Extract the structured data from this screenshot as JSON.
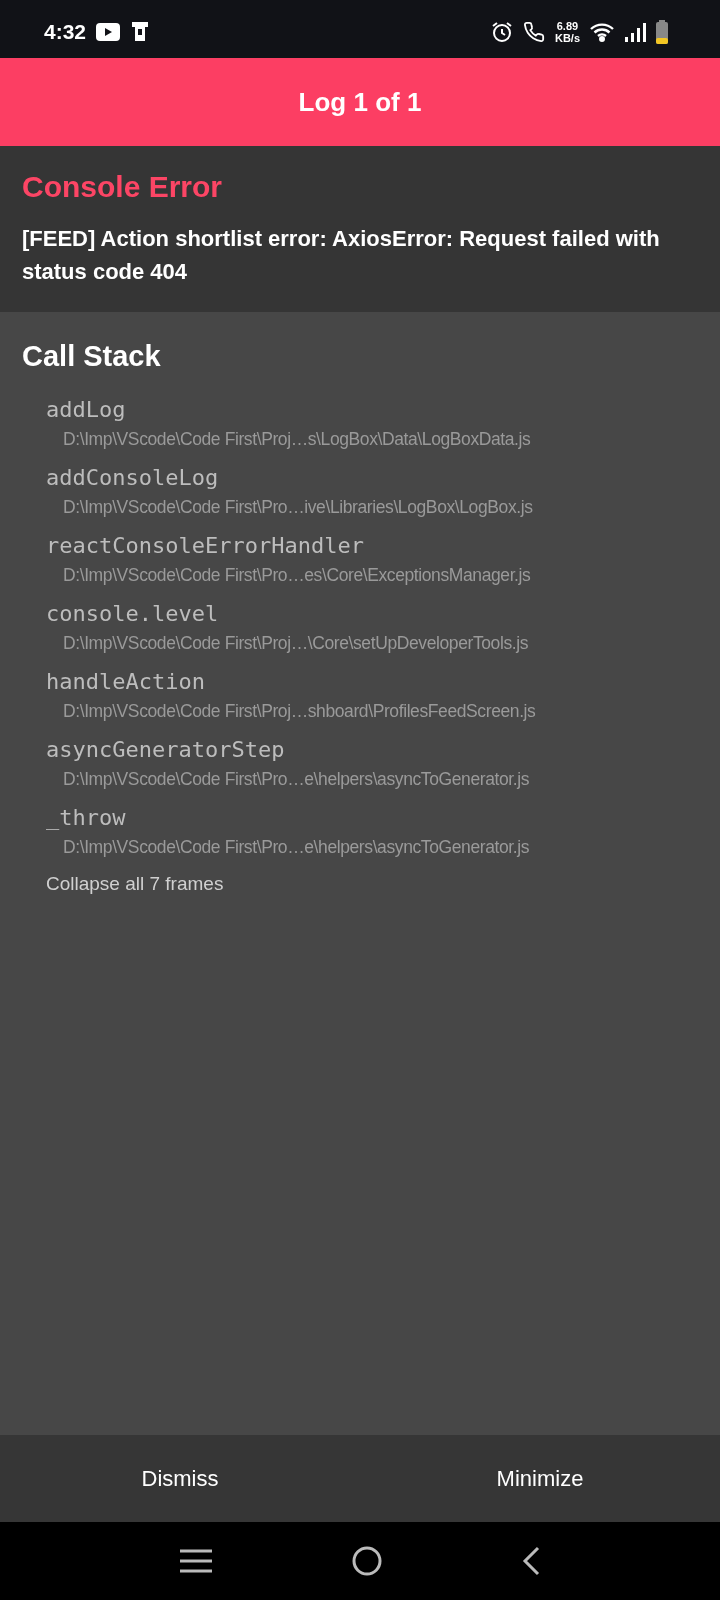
{
  "status_bar": {
    "time": "4:32",
    "speed_value": "6.89",
    "speed_unit": "KB/s"
  },
  "header": {
    "title": "Log 1 of 1"
  },
  "error": {
    "title": "Console Error",
    "message": "[FEED] Action shortlist error: AxiosError: Request failed with status code 404"
  },
  "call_stack": {
    "title": "Call Stack",
    "frames": [
      {
        "name": "addLog",
        "path": "D:\\Imp\\VScode\\Code First\\Proj…s\\LogBox\\Data\\LogBoxData.js"
      },
      {
        "name": "addConsoleLog",
        "path": "D:\\Imp\\VScode\\Code First\\Pro…ive\\Libraries\\LogBox\\LogBox.js"
      },
      {
        "name": "reactConsoleErrorHandler",
        "path": "D:\\Imp\\VScode\\Code First\\Pro…es\\Core\\ExceptionsManager.js"
      },
      {
        "name": "console.level",
        "path": "D:\\Imp\\VScode\\Code First\\Proj…\\Core\\setUpDeveloperTools.js"
      },
      {
        "name": "handleAction",
        "path": "D:\\Imp\\VScode\\Code First\\Proj…shboard\\ProfilesFeedScreen.js"
      },
      {
        "name": "asyncGeneratorStep",
        "path": "D:\\Imp\\VScode\\Code First\\Pro…e\\helpers\\asyncToGenerator.js"
      },
      {
        "name": "_throw",
        "path": "D:\\Imp\\VScode\\Code First\\Pro…e\\helpers\\asyncToGenerator.js"
      }
    ],
    "collapse_label": "Collapse all 7 frames"
  },
  "footer": {
    "buttons": [
      "Dismiss",
      "Minimize"
    ]
  }
}
